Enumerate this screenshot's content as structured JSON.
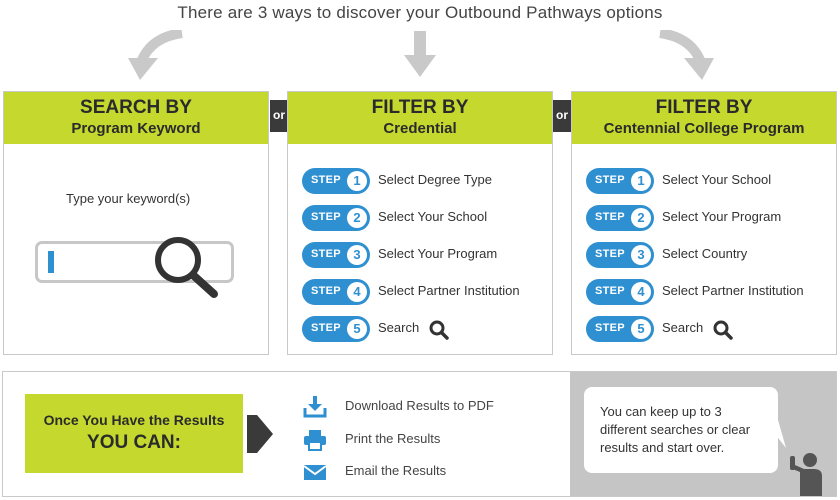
{
  "headline": "There are 3 ways to discover your Outbound Pathways options",
  "colors": {
    "accent_green": "#c4d82e",
    "step_blue": "#2e8fd1",
    "dark_gray": "#333333",
    "panel_gray": "#c5c5c5"
  },
  "connector_label": "or",
  "columns": [
    {
      "title": "SEARCH BY",
      "subtitle": "Program Keyword",
      "prompt": "Type your keyword(s)",
      "icon": "magnifier-icon"
    },
    {
      "title": "FILTER BY",
      "subtitle": "Credential",
      "step_word": "STEP",
      "steps": [
        {
          "num": "1",
          "label": "Select Degree Type"
        },
        {
          "num": "2",
          "label": "Select Your School"
        },
        {
          "num": "3",
          "label": "Select Your Program"
        },
        {
          "num": "4",
          "label": "Select Partner Institution"
        },
        {
          "num": "5",
          "label": "Search",
          "icon": "search-icon"
        }
      ]
    },
    {
      "title": "FILTER BY",
      "subtitle": "Centennial College Program",
      "step_word": "STEP",
      "steps": [
        {
          "num": "1",
          "label": "Select Your School"
        },
        {
          "num": "2",
          "label": "Select Your Program"
        },
        {
          "num": "3",
          "label": "Select Country"
        },
        {
          "num": "4",
          "label": "Select Partner Institution"
        },
        {
          "num": "5",
          "label": "Search",
          "icon": "search-icon"
        }
      ]
    }
  ],
  "results": {
    "line1": "Once You Have the Results",
    "line2": "YOU CAN:",
    "actions": [
      {
        "label": "Download Results to PDF",
        "icon": "download-icon"
      },
      {
        "label": "Print the Results",
        "icon": "printer-icon"
      },
      {
        "label": "Email the Results",
        "icon": "envelope-icon"
      }
    ]
  },
  "tip": "You can keep up to 3 different searches or clear results and start over."
}
